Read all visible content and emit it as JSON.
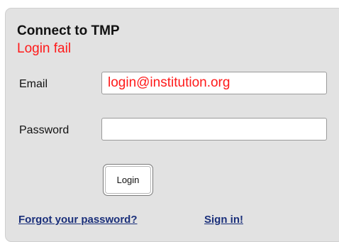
{
  "login_panel": {
    "title": "Connect to TMP",
    "error_message": "Login fail",
    "email": {
      "label": "Email",
      "value": "login@institution.org"
    },
    "password": {
      "label": "Password",
      "value": ""
    },
    "login_button_label": "Login",
    "forgot_password_link": "Forgot your password?",
    "sign_in_link": "Sign in!"
  },
  "colors": {
    "panel_background": "#e2e2e2",
    "error_text": "#ff1a1a",
    "link_text": "#1a2f7a"
  }
}
